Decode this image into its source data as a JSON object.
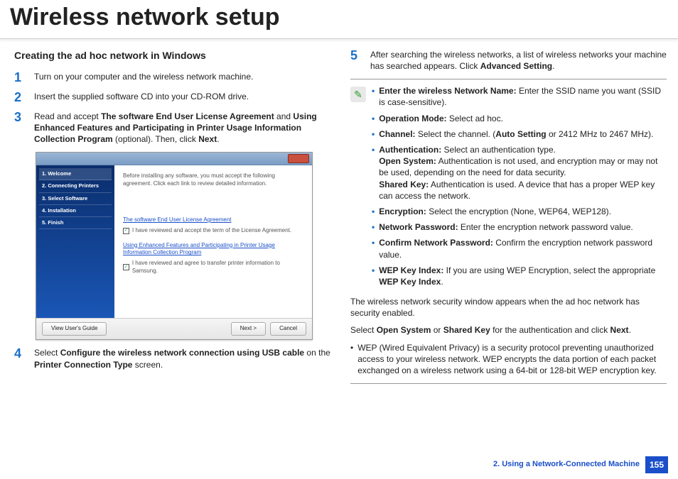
{
  "title": "Wireless network setup",
  "left": {
    "section_title": "Creating the ad hoc network in Windows",
    "steps": {
      "s1": {
        "num": "1",
        "text": "Turn on your computer and the wireless network machine."
      },
      "s2": {
        "num": "2",
        "text": "Insert the supplied software CD into your CD-ROM drive."
      },
      "s3": {
        "num": "3",
        "pre": "Read and accept ",
        "b1": "The software End User License Agreement",
        "mid1": "  and ",
        "b2": "Using Enhanced Features and Participating in Printer Usage Information Collection Program",
        "mid2": " (optional). Then, click ",
        "b3": "Next",
        "post": "."
      },
      "s4": {
        "num": "4",
        "pre": "Select ",
        "b1": "Configure the wireless network connection using USB cable",
        "mid": " on the ",
        "b2": "Printer Connection Type",
        "post": " screen."
      }
    },
    "installer": {
      "nav": [
        "1. Welcome",
        "2. Connecting Printers",
        "3. Select Software",
        "4. Installation",
        "5. Finish"
      ],
      "intro": "Before installing any software, you must accept the following agreement. Click each link to review detailed information.",
      "link1": "The software End User License Agreement",
      "chk1": "I have reviewed and accept the term of the License Agreement.",
      "link2": "Using Enhanced Features and Participating in Printer Usage Information Collection Program",
      "chk2": "I have reviewed and agree to transfer printer information to Samsung.",
      "btn_guide": "View User's Guide",
      "btn_next": "Next >",
      "btn_cancel": "Cancel"
    }
  },
  "right": {
    "step5": {
      "num": "5",
      "text_pre": "After searching the wireless networks, a list of wireless networks your machine has searched appears. Click ",
      "bold": "Advanced Setting",
      "post": "."
    },
    "note": [
      {
        "b": "Enter the wireless Network Name:",
        "r": " Enter the SSID name you want (SSID is case-sensitive)."
      },
      {
        "b": "Operation Mode:",
        "r": " Select ad hoc."
      },
      {
        "b": "Channel:",
        "r_pre": " Select the channel. (",
        "b2": "Auto Setting",
        "r_post": " or 2412 MHz to 2467 MHz)."
      },
      {
        "b": "Authentication:",
        "r": " Select an authentication type.",
        "lines": [
          {
            "b": "Open System:",
            "r": " Authentication is not used, and encryption may or may not be used, depending on the need for data security."
          },
          {
            "b": "Shared Key:",
            "r": " Authentication is used. A device that has a proper WEP key can access the network."
          }
        ]
      },
      {
        "b": "Encryption:",
        "r": " Select the encryption (None, WEP64, WEP128)."
      },
      {
        "b": "Network Password:",
        "r": " Enter the encryption network password value."
      },
      {
        "b": "Confirm Network Password:",
        "r": " Confirm the encryption network password value."
      },
      {
        "b": "WEP Key Index:",
        "r_pre": " If you are using WEP Encryption, select the appropriate ",
        "b2": "WEP Key Index",
        "r_post": "."
      }
    ],
    "after1": "The wireless network security window appears when the ad hoc network has security enabled.",
    "after2_pre": "Select ",
    "after2_b1": "Open System",
    "after2_mid1": " or ",
    "after2_b2": "Shared Key",
    "after2_mid2": " for the authentication and click ",
    "after2_b3": "Next",
    "after2_post": ".",
    "wep_bullet": "WEP (Wired Equivalent Privacy) is a security protocol preventing unauthorized access to your wireless network. WEP encrypts the data portion of each packet exchanged on a wireless network using a 64-bit or 128-bit WEP encryption key."
  },
  "footer": {
    "chapter": "2.  Using a Network-Connected Machine",
    "page": "155"
  }
}
